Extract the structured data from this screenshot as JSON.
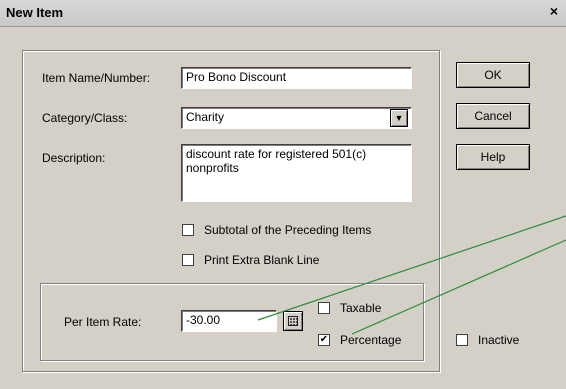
{
  "window": {
    "title": "New Item",
    "close_glyph": "×"
  },
  "form": {
    "item_name_label": "Item Name/Number:",
    "item_name_value": "Pro Bono Discount",
    "category_label": "Category/Class:",
    "category_value": "Charity",
    "description_label": "Description:",
    "description_value": "discount rate for registered 501(c) nonprofits",
    "subtotal_label": "Subtotal of the Preceding Items",
    "subtotal_checked": false,
    "blank_line_label": "Print Extra Blank Line",
    "blank_line_checked": false
  },
  "rate_group": {
    "per_item_rate_label": "Per Item Rate:",
    "per_item_rate_value": "-30.00",
    "taxable_label": "Taxable",
    "taxable_checked": false,
    "percentage_label": "Percentage",
    "percentage_checked": true,
    "check_glyph": "✔"
  },
  "side": {
    "inactive_label": "Inactive",
    "inactive_checked": false
  },
  "buttons": {
    "ok": "OK",
    "cancel": "Cancel",
    "help": "Help"
  },
  "icons": {
    "dropdown": "chevron-down-icon",
    "calculator": "calculator-icon",
    "close": "close-icon"
  },
  "colors": {
    "dialog_bg": "#d4d0c8",
    "annotation_line": "#2e8b3a"
  }
}
